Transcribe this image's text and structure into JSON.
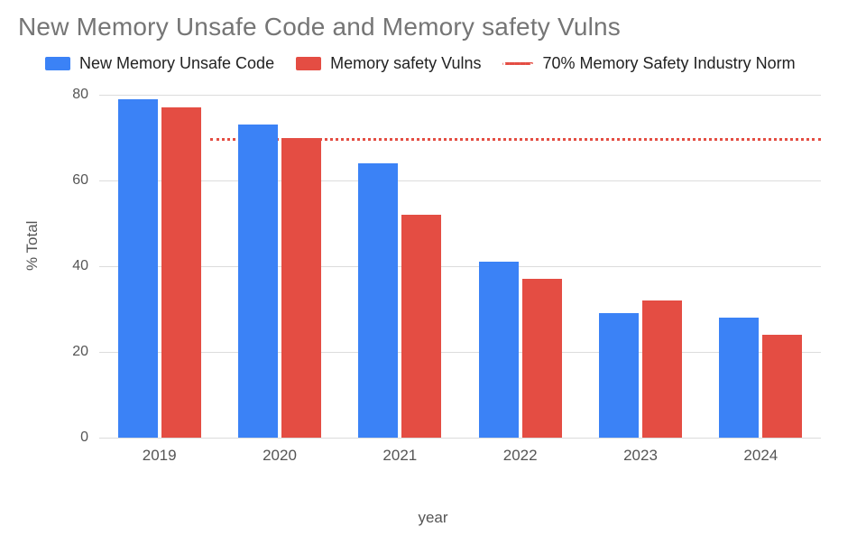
{
  "chart_data": {
    "type": "bar",
    "title": "New Memory Unsafe Code and Memory safety Vulns",
    "xlabel": "year",
    "ylabel": "% Total",
    "ylim": [
      0,
      80
    ],
    "yticks": [
      0,
      20,
      40,
      60,
      80
    ],
    "categories": [
      "2019",
      "2020",
      "2021",
      "2022",
      "2023",
      "2024"
    ],
    "series": [
      {
        "name": "New Memory Unsafe Code",
        "color": "#3b82f6",
        "values": [
          79,
          73,
          64,
          41,
          29,
          28
        ]
      },
      {
        "name": "Memory safety Vulns",
        "color": "#e44d43",
        "values": [
          77,
          70,
          52,
          37,
          32,
          24
        ]
      }
    ],
    "reference_line": {
      "name": "70% Memory Safety Industry Norm",
      "value": 70,
      "style": "dotted",
      "color": "#e44d43"
    },
    "legend_position": "top"
  }
}
